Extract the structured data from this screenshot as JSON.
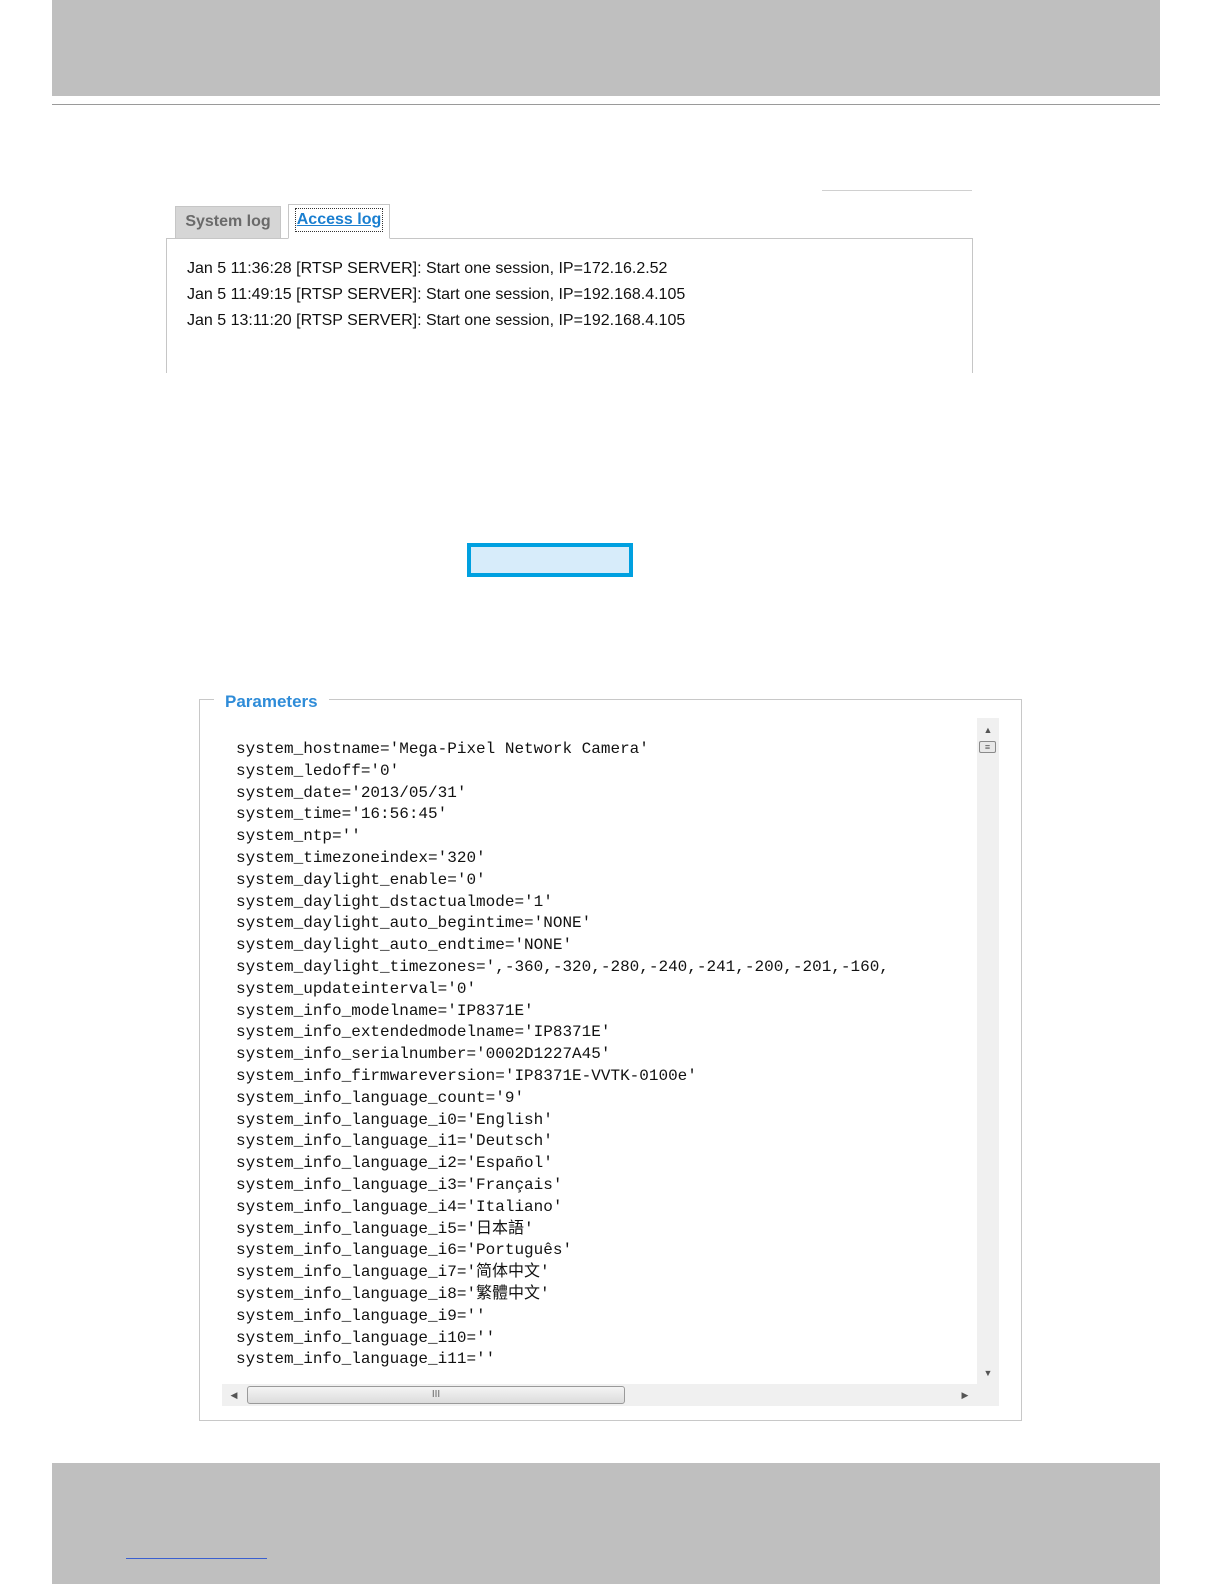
{
  "log_viewer": {
    "tabs": [
      {
        "label": "System log",
        "active": false
      },
      {
        "label": "Access log",
        "active": true
      }
    ],
    "entries": [
      "Jan 5 11:36:28 [RTSP SERVER]: Start one session, IP=172.16.2.52",
      "Jan 5 11:49:15 [RTSP SERVER]: Start one session, IP=192.168.4.105",
      "Jan 5 13:11:20 [RTSP SERVER]: Start one session, IP=192.168.4.105"
    ]
  },
  "parameters": {
    "legend": "Parameters",
    "lines": [
      "system_hostname='Mega-Pixel Network Camera'",
      "system_ledoff='0'",
      "system_date='2013/05/31'",
      "system_time='16:56:45'",
      "system_ntp=''",
      "system_timezoneindex='320'",
      "system_daylight_enable='0'",
      "system_daylight_dstactualmode='1'",
      "system_daylight_auto_begintime='NONE'",
      "system_daylight_auto_endtime='NONE'",
      "system_daylight_timezones=',-360,-320,-280,-240,-241,-200,-201,-160,",
      "system_updateinterval='0'",
      "system_info_modelname='IP8371E'",
      "system_info_extendedmodelname='IP8371E'",
      "system_info_serialnumber='0002D1227A45'",
      "system_info_firmwareversion='IP8371E-VVTK-0100e'",
      "system_info_language_count='9'",
      "system_info_language_i0='English'",
      "system_info_language_i1='Deutsch'",
      "system_info_language_i2='Español'",
      "system_info_language_i3='Français'",
      "system_info_language_i4='Italiano'",
      "system_info_language_i5='日本語'",
      "system_info_language_i6='Português'",
      "system_info_language_i7='简体中文'",
      "system_info_language_i8='繁體中文'",
      "system_info_language_i9=''",
      "system_info_language_i10=''",
      "system_info_language_i11=''"
    ]
  },
  "icons": {
    "scroll_up": "scroll-up-arrow-icon",
    "scroll_down": "scroll-down-arrow-icon",
    "scroll_left": "scroll-left-arrow-icon",
    "scroll_right": "scroll-right-arrow-icon"
  },
  "colors": {
    "band_gray": "#bfbfbf",
    "active_tab_text": "#1a7fd0",
    "legend_blue": "#2f8cd8",
    "highlight_border": "#00a0e0",
    "highlight_fill": "#d7ecfa"
  }
}
